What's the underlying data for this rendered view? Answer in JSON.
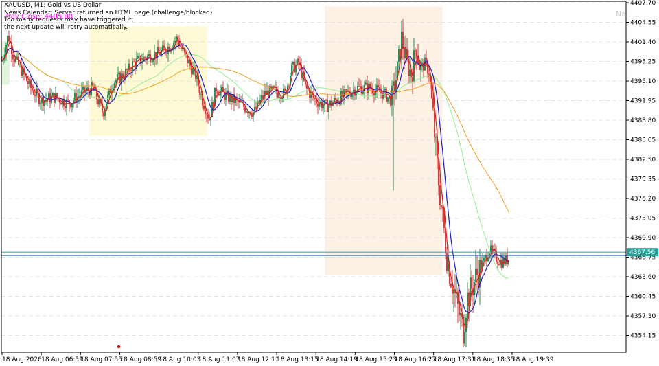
{
  "header": {
    "symbol_line": "XAUUSD, M1:  Gold vs US Dollar",
    "news_line1": "News Calendar: Server returned an HTML page (challenge/blocked).",
    "news_line2": "Too many requests may have triggered it;",
    "news_line3": "the next update will retry automatically.",
    "prev_close": "Prev Close: 4405.80",
    "na_text": "Na"
  },
  "chart_data": {
    "type": "candlestick",
    "symbol": "XAUUSD",
    "timeframe": "M1",
    "price_ticks": [
      "4407.70",
      "4404.55",
      "4401.40",
      "4398.25",
      "4395.10",
      "4391.95",
      "4388.80",
      "4385.65",
      "4382.50",
      "4379.35",
      "4376.20",
      "4373.05",
      "4369.90",
      "4366.75",
      "4363.60",
      "4360.45",
      "4357.30",
      "4354.15"
    ],
    "time_ticks": [
      "18 Aug 2026",
      "18 Aug 06:51",
      "18 Aug 07:55",
      "18 Aug 08:59",
      "18 Aug 10:03",
      "18 Aug 11:07",
      "18 Aug 12:11",
      "18 Aug 13:15",
      "18 Aug 14:19",
      "18 Aug 15:23",
      "18 Aug 16:27",
      "18 Aug 17:31",
      "18 Aug 18:35",
      "18 Aug 19:39"
    ],
    "ylim": [
      4352.7,
      4407.7
    ],
    "current_price": "4367.56",
    "current_price_value": 4367.56,
    "session_boxes": [
      {
        "from_time": "18 Aug 07:55",
        "to_time": "18 Aug 11:07",
        "price_high": 4403.9,
        "price_low": 4386.3,
        "color": "#fffad6"
      },
      {
        "from_time": "18 Aug 14:19",
        "to_time": "18 Aug 17:31",
        "price_high": 4407.1,
        "price_low": 4363.9,
        "color": "#fdf0e4"
      }
    ],
    "series_colors": {
      "bull": "#2e8b57",
      "bear": "#d04040",
      "ma_fast": "#e02020",
      "ma_mid": "#1e1ec8",
      "ma_slow": "#90ee90",
      "ma_long": "#f0a020",
      "price_line": "#2aa198"
    },
    "grid": true
  }
}
